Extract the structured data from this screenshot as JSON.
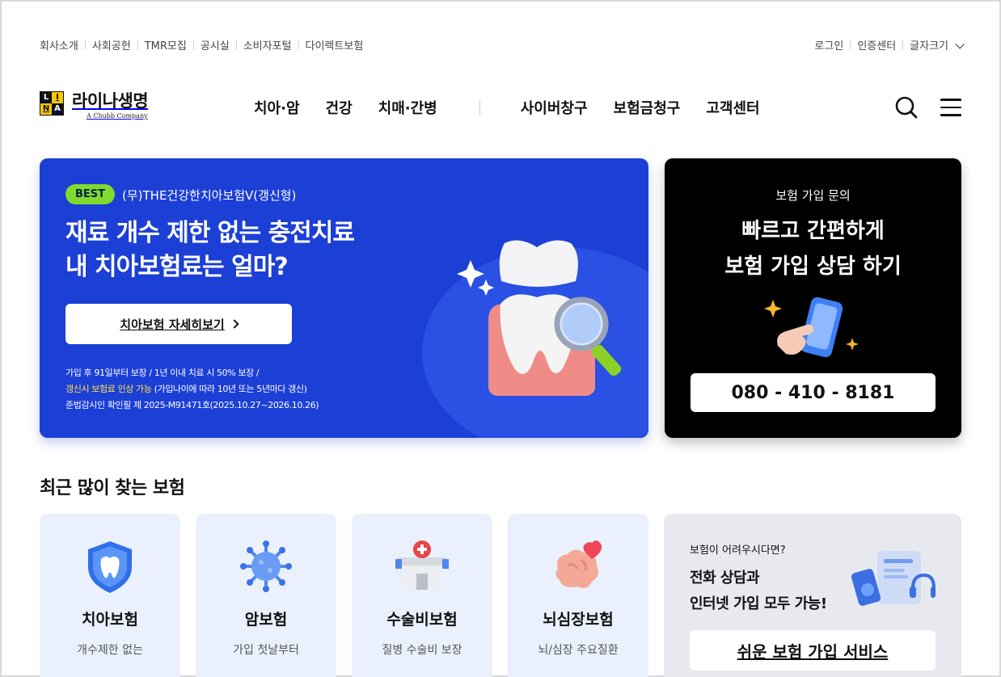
{
  "util": {
    "left": [
      "회사소개",
      "사회공헌",
      "TMR모집",
      "공시실",
      "소비자포털",
      "다이렉트보험"
    ],
    "right": [
      "로그인",
      "인증센터",
      "글자크기"
    ]
  },
  "logo": {
    "mark": [
      "L",
      "I",
      "N",
      "A"
    ],
    "name": "라이나생명",
    "sub": "A Chubb Company"
  },
  "gnb": {
    "primary": [
      "치아·암",
      "건강",
      "치매·간병"
    ],
    "secondary": [
      "사이버창구",
      "보험금청구",
      "고객센터"
    ]
  },
  "hero": {
    "badge": "BEST",
    "product": "(무)THE건강한치아보험V(갱신형)",
    "title_line1": "재료 개수 제한 없는 충전치료",
    "title_line2": "내 치아보험료는 얼마?",
    "button": "치아보험 자세히보기",
    "note1": "가입 후 91일부터 보장 / 1년 이내 치료 시 50% 보장 /",
    "note2_highlight": "갱신시 보험료 인상 가능",
    "note2_rest": " (가입나이에 따라 10년 또는 5년마다 갱신)",
    "note3": "준법감시인 확인필 제 2025-M91471호(2025.10.27~2026.10.26)",
    "colors": {
      "bg": "#1c3fd6",
      "badge": "#7fdc2d",
      "highlight": "#ffe14a"
    }
  },
  "consult": {
    "sub": "보험 가입 문의",
    "title_line1": "빠르고 간편하게",
    "title_line2": "보험 가입 상담 하기",
    "phone": "080 - 410 - 8181"
  },
  "recent": {
    "title": "최근 많이 찾는 보험",
    "cards": [
      {
        "name": "치아보험",
        "desc": "개수제한 없는",
        "icon": "tooth-shield-icon"
      },
      {
        "name": "암보험",
        "desc": "가입 첫날부터",
        "icon": "virus-icon"
      },
      {
        "name": "수술비보험",
        "desc": "질병 수술비 보장",
        "icon": "hospital-icon"
      },
      {
        "name": "뇌심장보험",
        "desc": "뇌/심장 주요질환",
        "icon": "brain-heart-icon"
      }
    ],
    "easy": {
      "sub": "보험이 어려우시다면?",
      "title_line1": "전화 상담과",
      "title_line2": "인터넷 가입 모두 가능!",
      "button": "쉬운 보험 가입 서비스"
    }
  }
}
